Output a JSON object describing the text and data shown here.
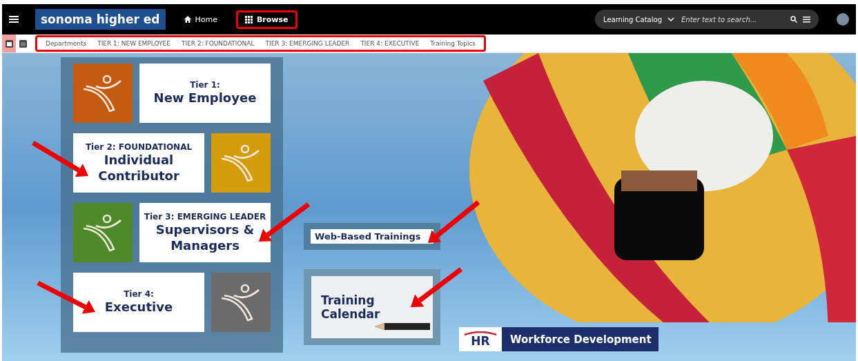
{
  "header": {
    "logo": [
      "sonoma",
      "higher ed"
    ],
    "nav": [
      {
        "label": "Home",
        "selected": false
      },
      {
        "label": "Browse",
        "selected": true
      }
    ],
    "search": {
      "scope": "Learning Catalog",
      "placeholder": "Enter text to search..."
    }
  },
  "subnav": {
    "views": [
      {
        "selected": true
      },
      {
        "selected": false
      }
    ],
    "tabs": [
      "Departments",
      "TIER 1: NEW EMPLOYEE",
      "TIER 2: FOUNDATIONAL",
      "TIER 3: EMERGING LEADER",
      "TIER 4: EXECUTIVE",
      "Training Topics"
    ]
  },
  "tiers": [
    {
      "label": "Tier 1:",
      "title": "New Employee",
      "color": "#c55a11",
      "kind": "iconleft"
    },
    {
      "label": "Tier 2: FOUNDATIONAL",
      "title": "Individual Contributor",
      "color": "#d49b0a",
      "kind": "iconright"
    },
    {
      "label": "Tier 3: EMERGING LEADER",
      "title": "Supervisors & Managers",
      "color": "#4e8a2a",
      "kind": "iconleft"
    },
    {
      "label": "Tier 4:",
      "title": "Executive",
      "color": "#6b6b6b",
      "kind": "iconright"
    }
  ],
  "web_trainings": "Web-Based Trainings",
  "calendar": "Training Calendar",
  "hr_logo": "HR",
  "banner": "Workforce Development"
}
